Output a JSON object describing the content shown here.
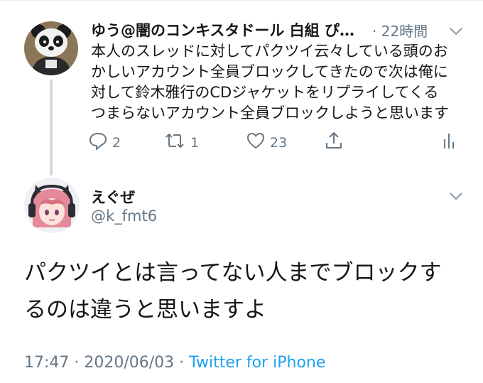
{
  "parent_tweet": {
    "display_name": "ゆう@闇のコンキスタドール 白組 ぴゅ…",
    "time": "· 22時間",
    "text": "本人のスレッドに対してパクツイ云々している頭のお\nかしいアカウント全員ブロックしてきたので次は俺に\n対して鈴木雅行のCDジャケットをリプライしてくる\nつまらないアカウント全員ブロックしようと思います",
    "replies": "2",
    "retweets": "1",
    "likes": "23",
    "avatar_icon": "panda-avatar"
  },
  "reply_tweet": {
    "display_name": "えぐぜ",
    "handle": "@k_fmt6",
    "text": "パクツイとは言ってない人までブロックす\nるのは違うと思いますよ",
    "timestamp": "17:47 · 2020/06/03 · ",
    "source": "Twitter for iPhone",
    "avatar_icon": "anime-girl-avatar"
  },
  "colors": {
    "text": "#14171a",
    "secondary": "#657786",
    "accent": "#1da1f2",
    "divider": "#e6ecf0"
  }
}
